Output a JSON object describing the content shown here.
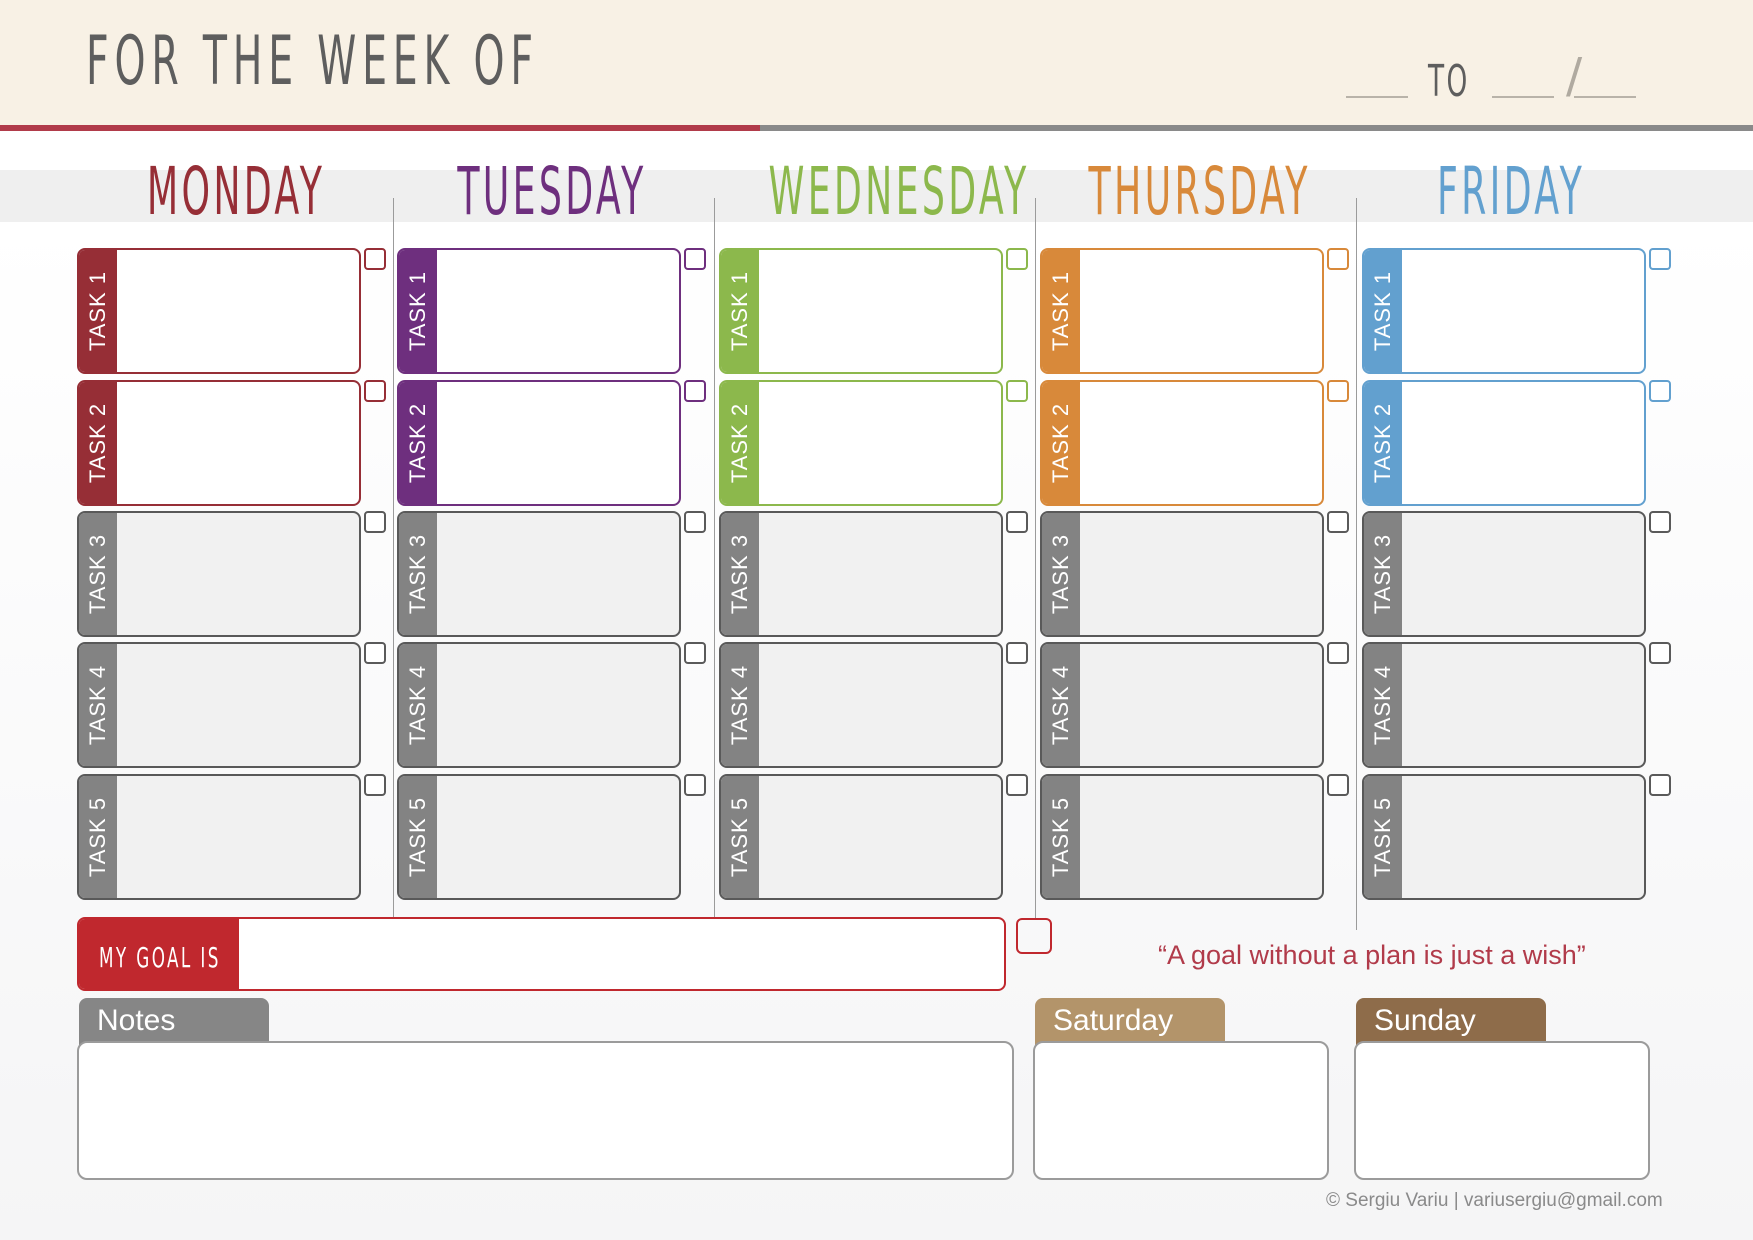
{
  "header": {
    "title": "FOR THE WEEK OF",
    "to_label": "TO",
    "date_slash": "/"
  },
  "days": [
    {
      "name": "MONDAY",
      "color": "#962e36"
    },
    {
      "name": "TUESDAY",
      "color": "#6e2f7e"
    },
    {
      "name": "WEDNESDAY",
      "color": "#8cb84c"
    },
    {
      "name": "THURSDAY",
      "color": "#d8893a"
    },
    {
      "name": "FRIDAY",
      "color": "#62a0cf"
    }
  ],
  "tasks": {
    "labels": [
      "TASK 1",
      "TASK 2",
      "TASK 3",
      "TASK 4",
      "TASK 5"
    ],
    "inactive_color": "#838383"
  },
  "goal": {
    "label": "MY GOAL IS",
    "color": "#c0282e"
  },
  "quote": "“A goal without a plan is just a wish”",
  "sections": {
    "notes": {
      "label": "Notes",
      "color": "#868686"
    },
    "saturday": {
      "label": "Saturday",
      "color": "#b3946a"
    },
    "sunday": {
      "label": "Sunday",
      "color": "#8e6c4a"
    }
  },
  "footer": "© Sergiu Variu | variusergiu@gmail.com"
}
